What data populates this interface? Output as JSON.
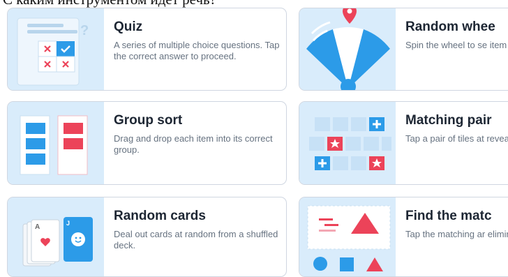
{
  "heading": "С каким инструментом идет речь?",
  "colors": {
    "thumb_bg": "#d9ecfb",
    "card_border": "#cfd6e1",
    "title": "#1d2633",
    "desc": "#667280",
    "accent_blue": "#2c9be8",
    "accent_red": "#ec4359"
  },
  "templates": [
    {
      "title": "Quiz",
      "desc": "A series of multiple choice questions. Tap the correct answer to proceed.",
      "icon": "quiz-icon"
    },
    {
      "title": "Random whee",
      "desc": "Spin the wheel to se item comes up next",
      "icon": "random-wheel-icon"
    },
    {
      "title": "Group sort",
      "desc": "Drag and drop each item into its correct group.",
      "icon": "group-sort-icon"
    },
    {
      "title": "Matching pair",
      "desc": "Tap a pair of tiles at reveal if they are a r",
      "icon": "matching-pairs-icon"
    },
    {
      "title": "Random cards",
      "desc": "Deal out cards at random from a shuffled deck.",
      "icon": "random-cards-icon"
    },
    {
      "title": "Find the matc",
      "desc": "Tap the matching ar eliminate it. Repeat answers are gone.",
      "icon": "find-the-match-icon"
    }
  ]
}
